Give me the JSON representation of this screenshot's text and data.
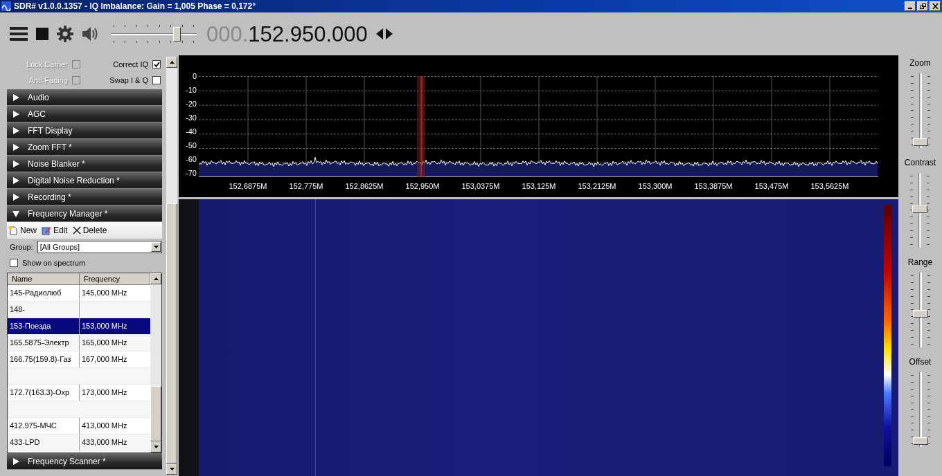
{
  "window": {
    "title": "SDR# v1.0.0.1357 - IQ Imbalance: Gain = 1,005 Phase = 0,172°"
  },
  "toolbar": {
    "volume": {
      "level": 0.8
    },
    "frequency_prefix": "000.",
    "frequency": "152.950.000"
  },
  "options": [
    {
      "label": "Lock Carrier",
      "checked": false,
      "disabled": true
    },
    {
      "label": "Correct IQ",
      "checked": true,
      "disabled": false
    },
    {
      "label": "Anti-Fading",
      "checked": false,
      "disabled": true
    },
    {
      "label": "Swap I & Q",
      "checked": false,
      "disabled": false
    }
  ],
  "sections": [
    {
      "label": "Audio",
      "expanded": false
    },
    {
      "label": "AGC",
      "expanded": false
    },
    {
      "label": "FFT Display",
      "expanded": false
    },
    {
      "label": "Zoom FFT *",
      "expanded": false
    },
    {
      "label": "Noise Blanker *",
      "expanded": false
    },
    {
      "label": "Digital Noise Reduction *",
      "expanded": false
    },
    {
      "label": "Recording *",
      "expanded": false
    },
    {
      "label": "Frequency Manager *",
      "expanded": true
    }
  ],
  "frequency_manager": {
    "actions": [
      {
        "kind": "new",
        "label": "New"
      },
      {
        "kind": "edit",
        "label": "Edit"
      },
      {
        "kind": "delete",
        "label": "Delete"
      }
    ],
    "group_label": "Group:",
    "group_value": "[All Groups]",
    "show_on_spectrum": {
      "label": "Show on spectrum",
      "checked": false
    },
    "columns": [
      "Name",
      "Frequency"
    ],
    "rows": [
      {
        "kind": "entry",
        "name": "145-Радиолюб",
        "frequency": "145,000 MHz",
        "selected": false
      },
      {
        "kind": "entry",
        "name": "148-",
        "selected": false
      },
      {
        "kind": "entry",
        "name": "153-Поезда",
        "frequency": "153,000 MHz",
        "selected": true
      },
      {
        "kind": "entry",
        "name": "165.5875-Электр",
        "frequency": "165,000 MHz",
        "selected": false
      },
      {
        "kind": "entry",
        "name": "166.75(159.8)-Газ",
        "frequency": "167,000 MHz",
        "selected": false
      },
      {
        "kind": "empty",
        "selected": false
      },
      {
        "kind": "entry",
        "name": "172.7(163.3)-Охр",
        "frequency": "173,000 MHz",
        "selected": false
      },
      {
        "kind": "empty",
        "selected": false
      },
      {
        "kind": "entry",
        "name": "412.975-МЧС",
        "frequency": "413,000 MHz",
        "selected": false
      },
      {
        "kind": "entry",
        "name": "433-LPD",
        "frequency": "433,000 MHz",
        "selected": false
      }
    ]
  },
  "sections_after": [
    {
      "label": "Frequency Scanner *",
      "expanded": false
    }
  ],
  "spectrum": {
    "y_labels": [
      "0",
      "-10",
      "-20",
      "-30",
      "-40",
      "-50",
      "-60",
      "-70"
    ],
    "x_labels": [
      "152,6875M",
      "152,775M",
      "152,8625M",
      "152,950M",
      "153,0375M",
      "153,125M",
      "153,2125M",
      "153,300M",
      "153,3875M",
      "153,475M",
      "153,5625M"
    ]
  },
  "side_sliders": [
    {
      "label": "Zoom",
      "level": 0
    },
    {
      "label": "Contrast",
      "level": 0.5
    },
    {
      "label": "Range",
      "level": 0.43
    },
    {
      "label": "Offset",
      "level": 0
    }
  ]
}
